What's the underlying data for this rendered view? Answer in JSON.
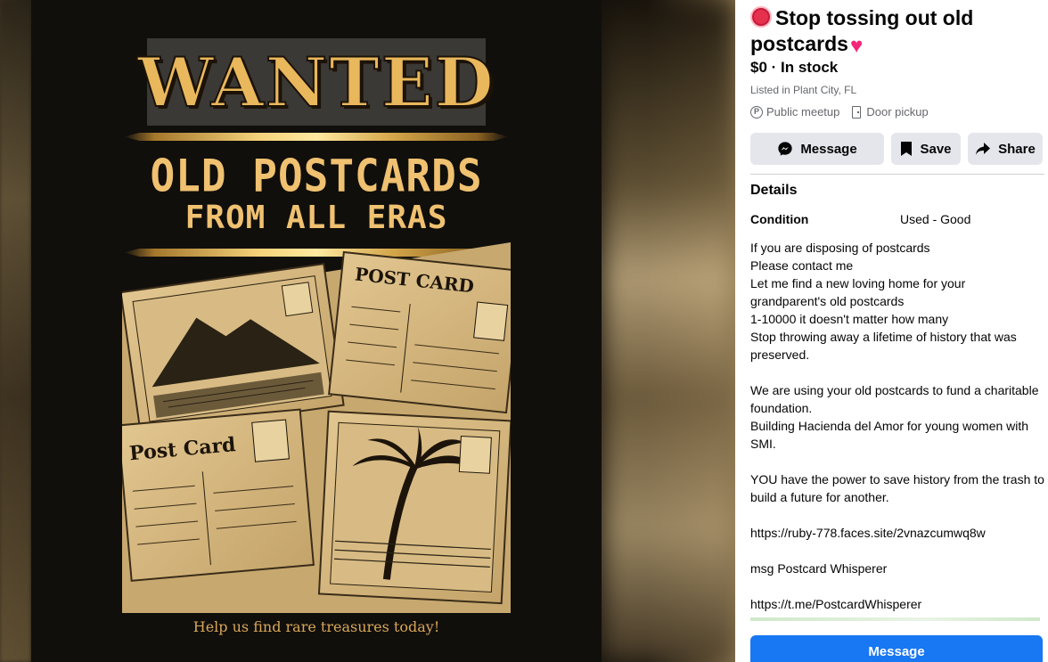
{
  "poster": {
    "wanted": "WANTED",
    "headline_1": "OLD POSTCARDS",
    "headline_2": "FROM ALL ERAS",
    "card_1_title": "POST CARD",
    "card_2_title": "Post Card",
    "tagline": "Help us find rare treasures today!"
  },
  "listing": {
    "title_text": "Stop tossing out old postcards",
    "title_emoji_left": "stop-sign-icon",
    "title_emoji_right": "heart-icon",
    "price": "$0 · In stock",
    "location": "Listed in Plant City, FL",
    "delivery": [
      {
        "label": "Public meetup",
        "icon": "parking-icon"
      },
      {
        "label": "Door pickup",
        "icon": "door-icon"
      }
    ]
  },
  "actions": {
    "message_label": "Message",
    "save_label": "Save",
    "share_label": "Share",
    "primary_message_label": "Message"
  },
  "details": {
    "heading": "Details",
    "condition_label": "Condition",
    "condition_value": "Used - Good",
    "description": "If you are disposing of postcards\nPlease contact me\nLet me find a new loving home for your grandparent's old postcards\n1-10000 it doesn't matter how many\nStop throwing away a lifetime of history that was preserved.\n\nWe are using your old postcards to fund a charitable foundation.\nBuilding Hacienda del Amor for young women with SMI.\n\nYOU have the power to save history from the trash to build a future for another.\n\nhttps://ruby-778.faces.site/2vnazcumwq8w\n\nmsg Postcard Whisperer\n\nhttps://t.me/PostcardWhisperer"
  },
  "colors": {
    "poster_gold": "#efc170",
    "primary_blue": "#1877f2",
    "secondary_button": "#e4e6eb",
    "muted_text": "#65676b"
  }
}
